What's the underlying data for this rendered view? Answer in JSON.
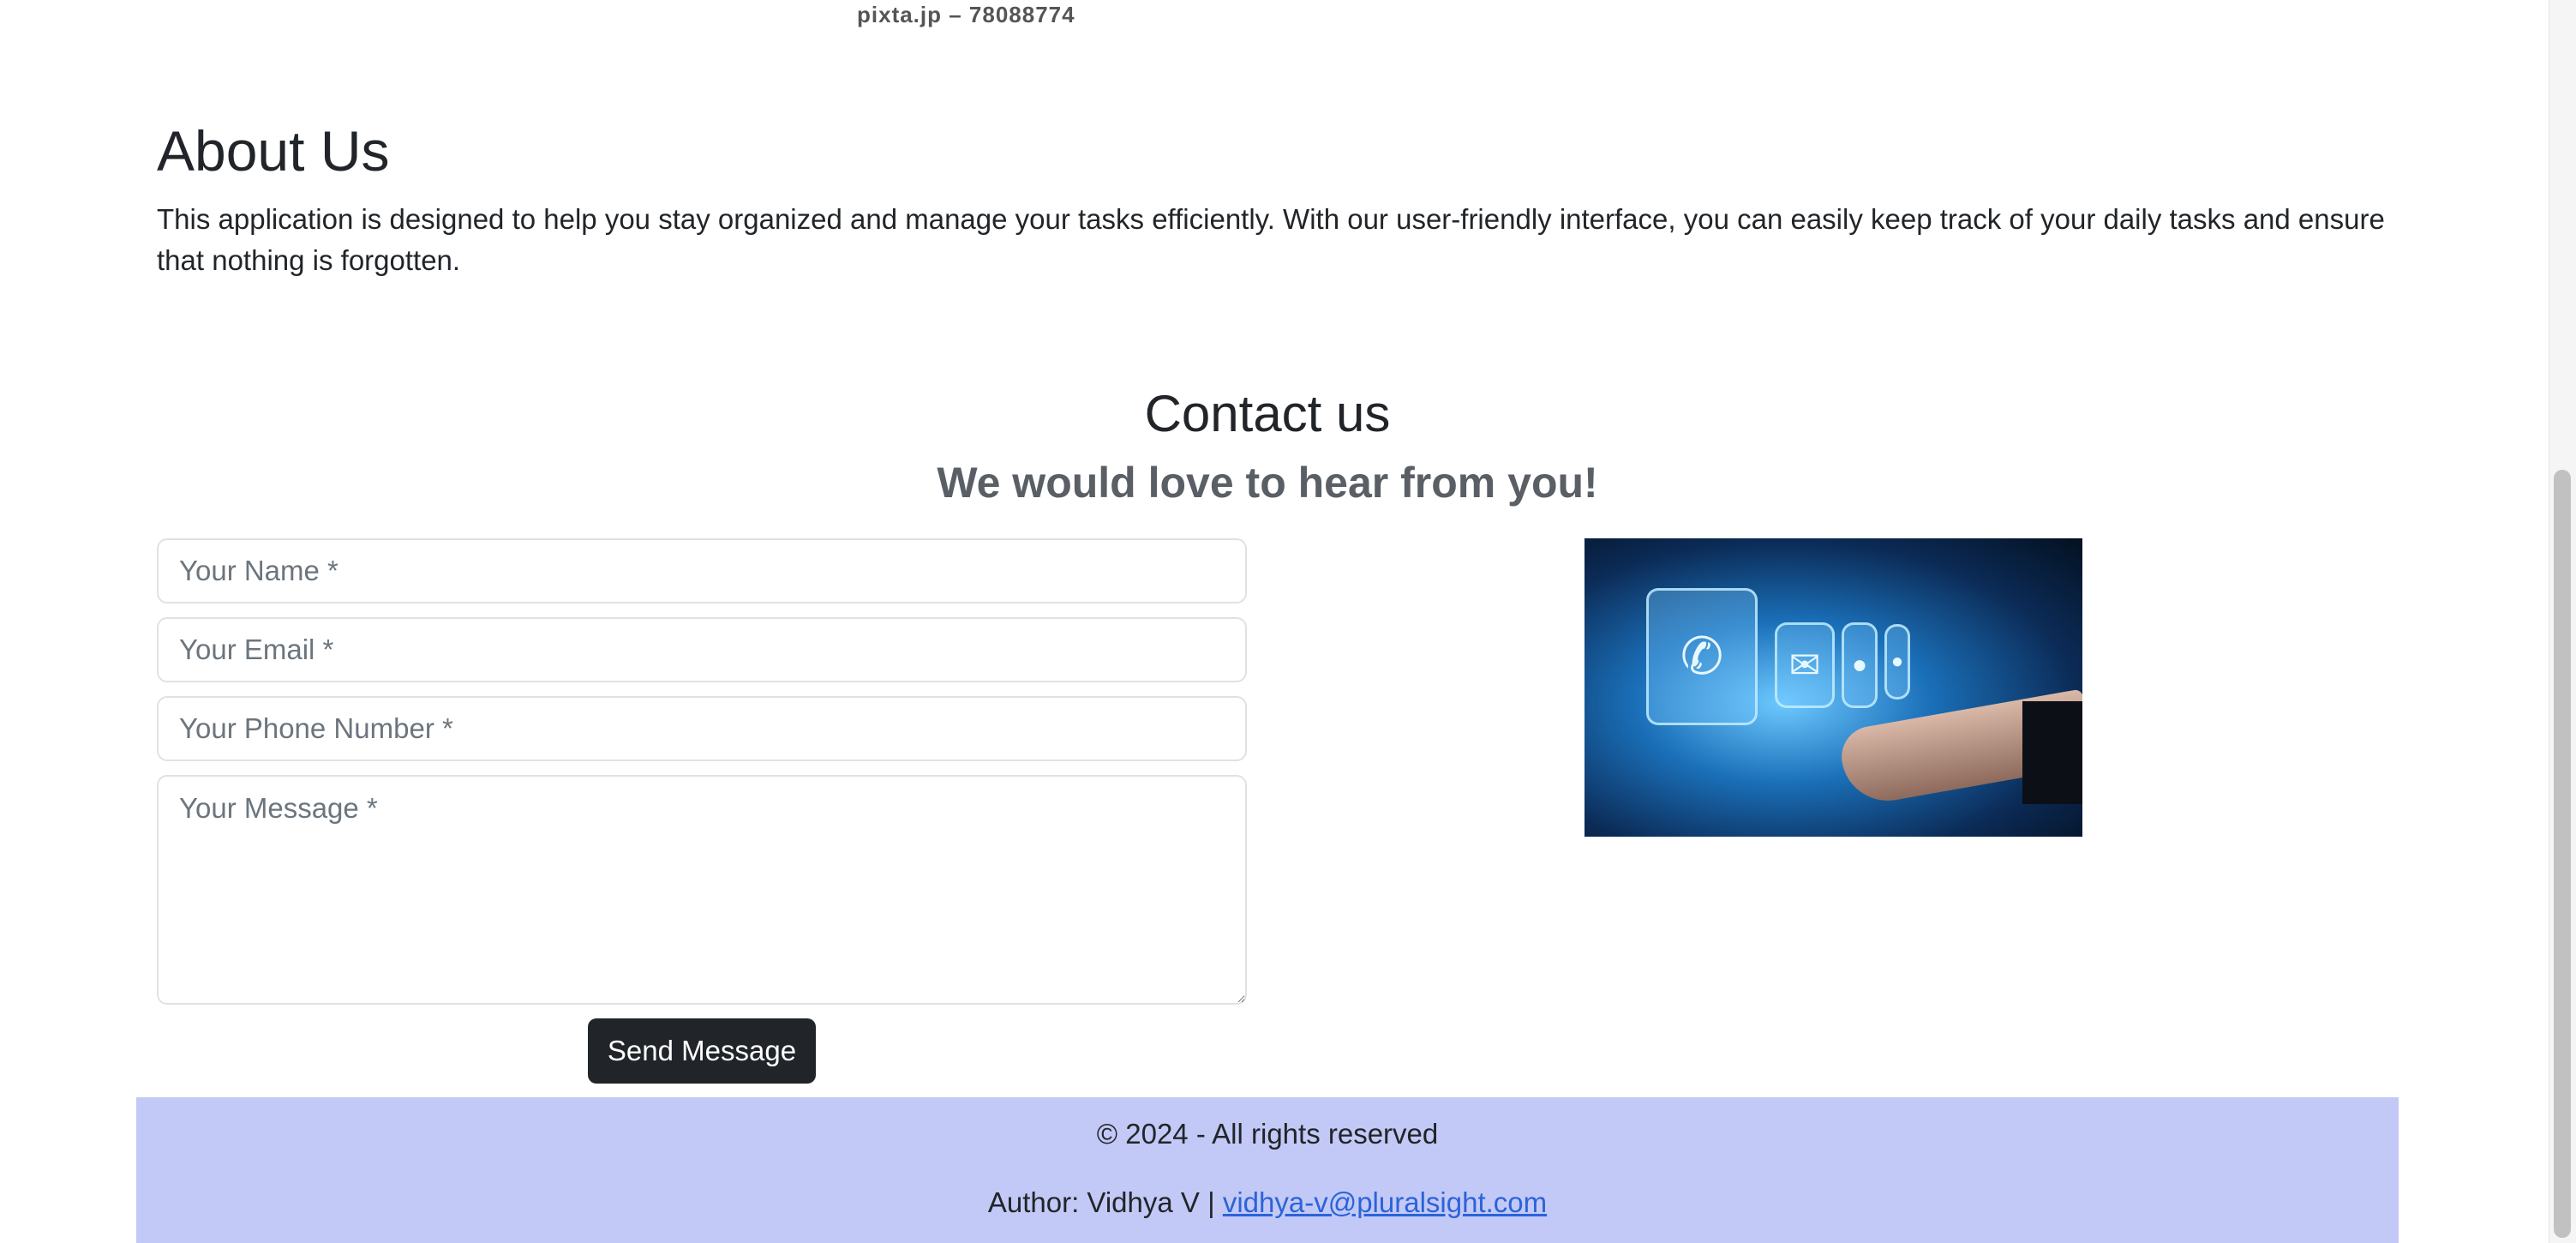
{
  "top_caption": "pixta.jp – 78088774",
  "about": {
    "title": "About Us",
    "text": "This application is designed to help you stay organized and manage your tasks efficiently. With our user-friendly interface, you can easily keep track of your daily tasks and ensure that nothing is forgotten."
  },
  "contact": {
    "title": "Contact us",
    "subtitle": "We would love to hear from you!",
    "form": {
      "name_placeholder": "Your Name *",
      "email_placeholder": "Your Email *",
      "phone_placeholder": "Your Phone Number *",
      "message_placeholder": "Your Message *",
      "submit_label": "Send Message"
    },
    "image": {
      "icons": [
        "phone-icon",
        "mail-icon",
        "location-pin-icon",
        "chat-bubble-icon"
      ]
    }
  },
  "footer": {
    "copyright": "© 2024 - All rights reserved",
    "author_prefix": "Author: Vidhya V | ",
    "author_email": "vidhya-v@pluralsight.com",
    "background_color": "#c3c9f6",
    "link_color": "#2b63d9"
  }
}
